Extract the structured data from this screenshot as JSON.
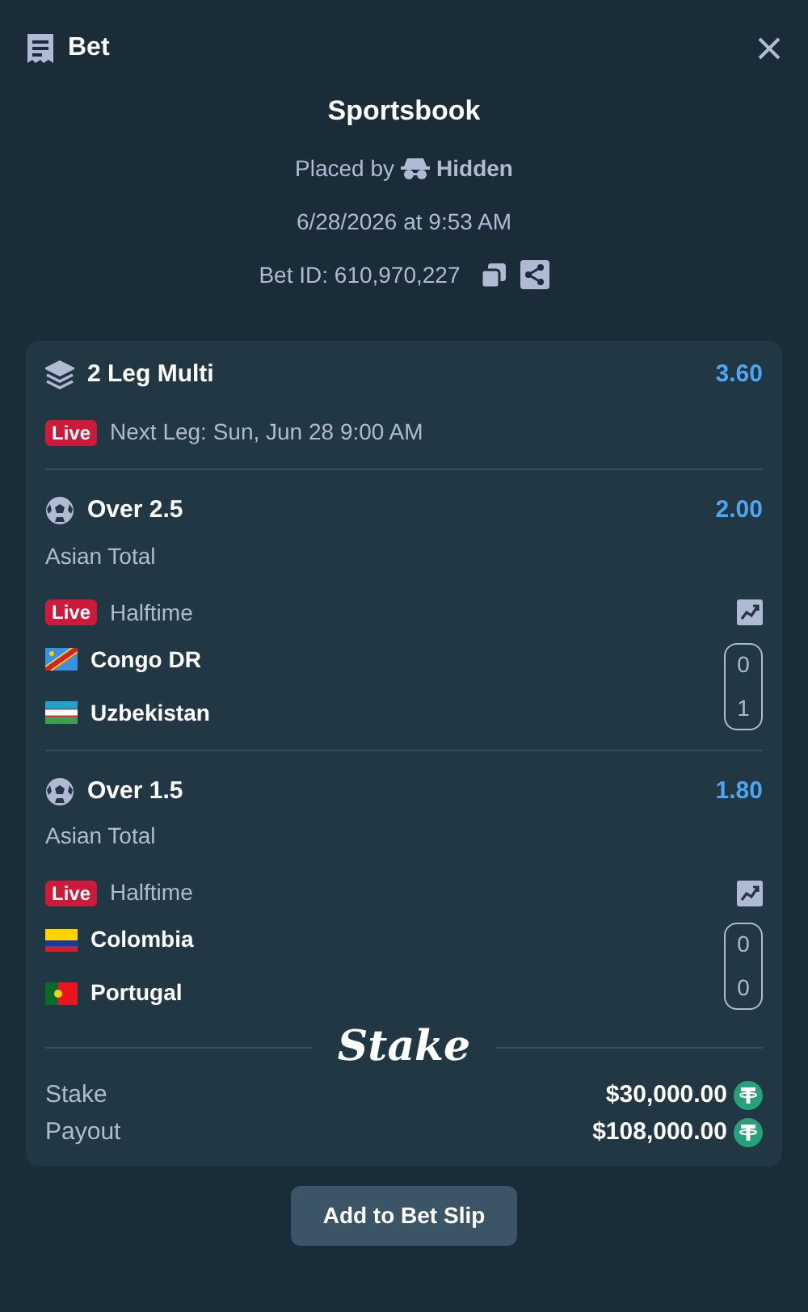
{
  "header": {
    "title": "Bet"
  },
  "summary": {
    "title": "Sportsbook",
    "placed_by_label": "Placed by",
    "placed_by_user": "Hidden",
    "date": "6/28/2026 at 9:53 AM",
    "bet_id": "Bet ID: 610,970,227"
  },
  "multi": {
    "title": "2 Leg Multi",
    "odds": "3.60",
    "live_badge": "Live",
    "next_leg": "Next Leg: Sun, Jun 28 9:00 AM"
  },
  "legs": [
    {
      "selection": "Over 2.5",
      "odds": "2.00",
      "market": "Asian Total",
      "live_badge": "Live",
      "status": "Halftime",
      "teams": [
        {
          "name": "Congo DR",
          "score": "0"
        },
        {
          "name": "Uzbekistan",
          "score": "1"
        }
      ]
    },
    {
      "selection": "Over 1.5",
      "odds": "1.80",
      "market": "Asian Total",
      "live_badge": "Live",
      "status": "Halftime",
      "teams": [
        {
          "name": "Colombia",
          "score": "0"
        },
        {
          "name": "Portugal",
          "score": "0"
        }
      ]
    }
  ],
  "brand": "Stake",
  "totals": [
    {
      "label": "Stake",
      "amount": "$30,000.00"
    },
    {
      "label": "Payout",
      "amount": "$108,000.00"
    }
  ],
  "button": "Add to Bet Slip"
}
